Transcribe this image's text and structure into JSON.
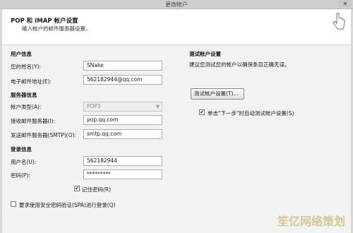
{
  "window": {
    "title": "更改帐户"
  },
  "header": {
    "title": "POP 和 IMAP 帐户设置",
    "subtitle": "输入帐户的邮件服务器设置。"
  },
  "user_info": {
    "section": "用户信息",
    "name_label": "您的姓名(Y):",
    "name_value": "SNake",
    "email_label": "电子邮件地址(E):",
    "email_value": "562182944@qq.com"
  },
  "server_info": {
    "section": "服务器信息",
    "type_label": "帐户类型(A):",
    "type_value": "POP3",
    "incoming_label": "接收邮件服务器(I):",
    "incoming_value": "pop.qq.com",
    "outgoing_label": "发送邮件服务器(SMTP)(O):",
    "outgoing_value": "smtp.qq.com"
  },
  "login_info": {
    "section": "登录信息",
    "user_label": "用户名(U):",
    "user_value": "562182944",
    "pass_label": "密码(P):",
    "pass_value": "*********",
    "remember_label": "记住密码(R)",
    "spa_label": "要求使用安全密码验证(SPA)进行登录(Q)"
  },
  "test": {
    "section": "测试帐户设置",
    "desc": "建议您测试您的帐户以确保条目正确无误。",
    "button": "测试帐户设置(T)...",
    "auto_label": "单击\"下一步\"时自动测试帐户设置(S)"
  },
  "watermark": "笙亿网络策划"
}
